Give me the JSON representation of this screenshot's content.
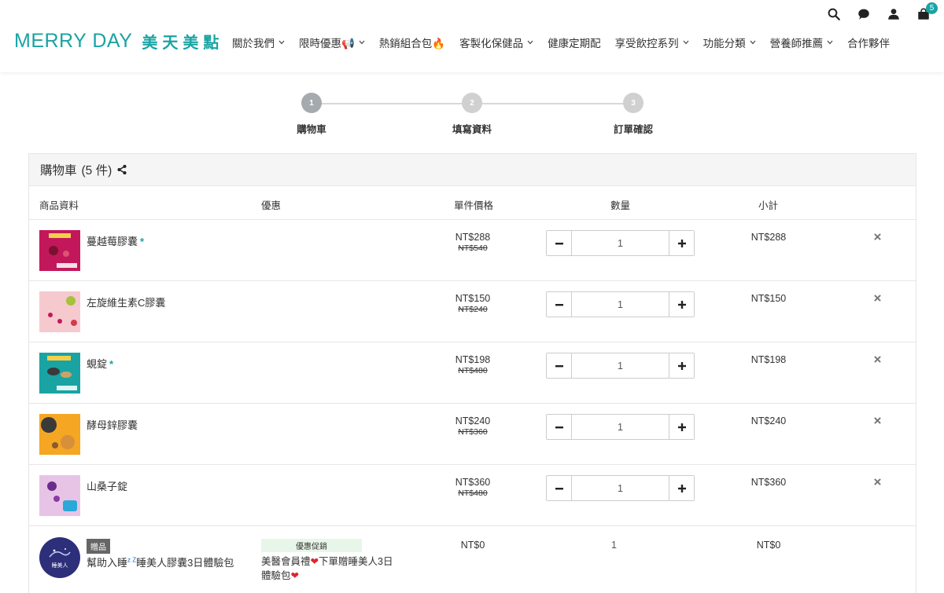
{
  "brand": {
    "en": "MERRY DAY",
    "zh": "美天美點"
  },
  "header": {
    "cart_count": "5",
    "nav": [
      {
        "label": "關於我們",
        "dropdown": true
      },
      {
        "label": "限時優惠📢",
        "dropdown": true
      },
      {
        "label": "熱銷組合包🔥",
        "dropdown": false
      },
      {
        "label": "客製化保健品",
        "dropdown": true
      },
      {
        "label": "健康定期配",
        "dropdown": false
      },
      {
        "label": "享受飲控系列",
        "dropdown": true
      },
      {
        "label": "功能分類",
        "dropdown": true
      },
      {
        "label": "營養師推薦",
        "dropdown": true
      },
      {
        "label": "合作夥伴",
        "dropdown": false
      }
    ]
  },
  "steps": [
    {
      "num": "1",
      "label": "購物車"
    },
    {
      "num": "2",
      "label": "填寫資料"
    },
    {
      "num": "3",
      "label": "訂單確認"
    }
  ],
  "cart": {
    "title": "購物車",
    "count_text": "(5 件)",
    "columns": {
      "product": "商品資料",
      "promo": "優惠",
      "unit_price": "單件價格",
      "quantity": "數量",
      "subtotal": "小計"
    },
    "items": [
      {
        "name": "蔓越莓膠囊",
        "starred": true,
        "price": "NT$288",
        "old_price": "NT$540",
        "qty": "1",
        "subtotal": "NT$288",
        "thumb_bg": "#c2185b"
      },
      {
        "name": "左旋維生素C膠囊",
        "starred": false,
        "price": "NT$150",
        "old_price": "NT$240",
        "qty": "1",
        "subtotal": "NT$150",
        "thumb_bg": "#f6c9cf"
      },
      {
        "name": "蜆錠",
        "starred": true,
        "price": "NT$198",
        "old_price": "NT$480",
        "qty": "1",
        "subtotal": "NT$198",
        "thumb_bg": "#1aa3a3"
      },
      {
        "name": "酵母鋅膠囊",
        "starred": false,
        "price": "NT$240",
        "old_price": "NT$360",
        "qty": "1",
        "subtotal": "NT$240",
        "thumb_bg": "#f5a623"
      },
      {
        "name": "山桑子錠",
        "starred": false,
        "price": "NT$360",
        "old_price": "NT$480",
        "qty": "1",
        "subtotal": "NT$360",
        "thumb_bg": "#e7c4e6"
      }
    ],
    "gift": {
      "badge": "贈品",
      "name_pre": "幫助入睡",
      "name_sup": "z Z",
      "name_post": "睡美人膠囊3日體驗包",
      "thumb_text": "睡美人",
      "promo_tag": "優惠促銷",
      "promo_text_1": "美醫會員禮",
      "promo_text_2": "下單贈睡美人3日體驗包",
      "price": "NT$0",
      "qty": "1",
      "subtotal": "NT$0"
    }
  }
}
